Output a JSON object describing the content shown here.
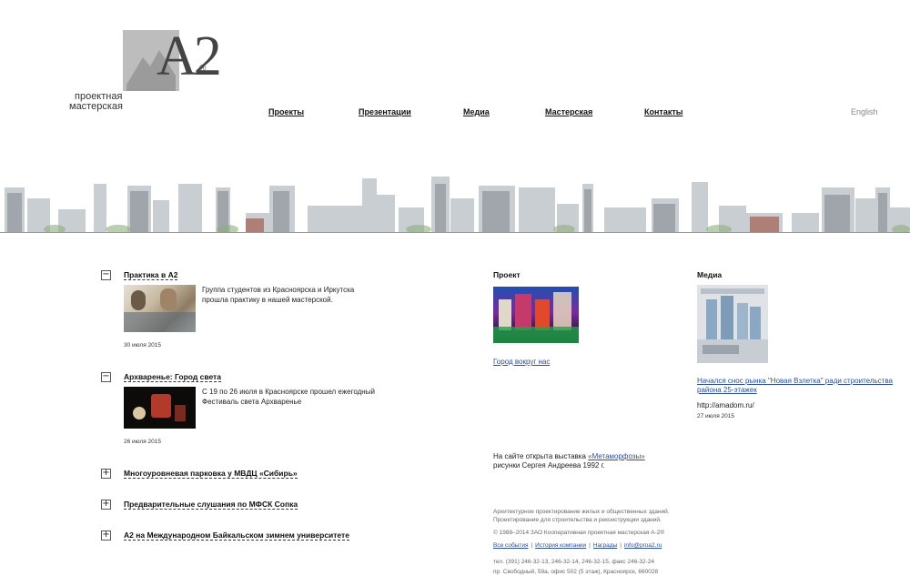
{
  "logo": {
    "mark": "A2",
    "registered": "®",
    "line1": "проектная",
    "line2": "мастерская"
  },
  "nav": {
    "items": [
      "Проекты",
      "Презентации",
      "Медиа",
      "Мастерская",
      "Контакты"
    ],
    "lang": "English"
  },
  "news": [
    {
      "toggle": "−",
      "title": "Практика в А2",
      "text": "Группа студентов из Красноярска и Иркутска прошла практику в нашей мастерской.",
      "date": "30 июля 2015"
    },
    {
      "toggle": "−",
      "title": "Архваренье: Город света",
      "text": "С 19 по 26 июля в Красноярске прошел ежегодный Фестиваль света Архваренье",
      "date": "26 июля 2015"
    },
    {
      "toggle": "+",
      "title": "Многоуровневая парковка у МВДЦ «Сибирь»"
    },
    {
      "toggle": "+",
      "title": "Предварительные слушания по МФСК Сопка"
    },
    {
      "toggle": "+",
      "title": "А2 на Международном Байкальском зимнем университете"
    }
  ],
  "project": {
    "heading": "Проект",
    "link": "Город вокруг нас",
    "exhibit_prefix": "На сайте открыта выставка ",
    "exhibit_link": "«Метаморфозы»",
    "exhibit_suffix": "рисунки Сергея Андреева 1992 г."
  },
  "media": {
    "heading": "Медиа",
    "link": "Начался снос рынка \"Новая Взлетка\" ради строительства района 25-этажек",
    "source": "http://amadom.ru/",
    "date": "27 июля 2015"
  },
  "footer": {
    "line1": "Архитектурное проектирование жилых и общественных зданий.",
    "line2": "Проектирование для строительства и реконструкции зданий.",
    "copyright": "© 1988–2014 ЗАО Кооперативная проектная мастерская А-2®",
    "links": [
      "Все события",
      "История компании",
      "Награды",
      "info@proa2.ru"
    ],
    "phone": "тел. (391) 246-32-13, 246-32-14, 246-32-15, факс 246-32-24",
    "address": "пр. Свободный, 59а, офис 502 (5 этаж), Красноярск, 660028"
  }
}
